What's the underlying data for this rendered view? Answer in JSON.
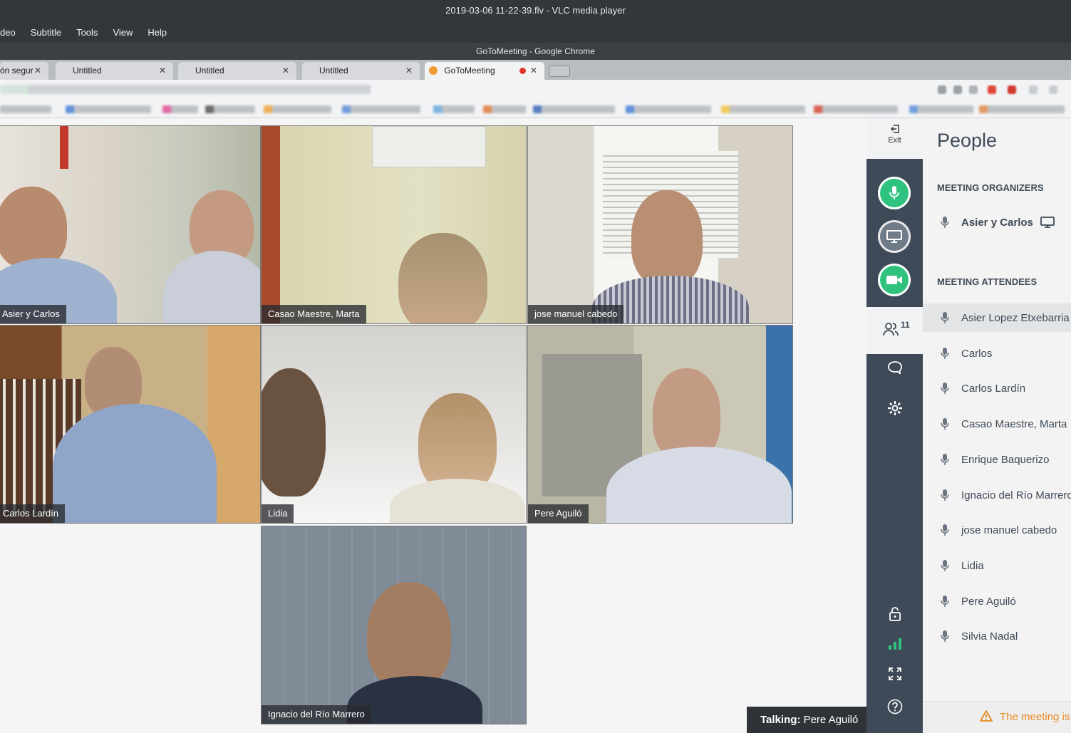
{
  "vlc": {
    "title": "2019-03-06 11-22-39.flv - VLC media player",
    "menu": [
      "deo",
      "Subtitle",
      "Tools",
      "View",
      "Help"
    ]
  },
  "chrome": {
    "title": "GoToMeeting - Google Chrome",
    "tabs": [
      {
        "label": "ón segur"
      },
      {
        "label": "Untitled"
      },
      {
        "label": "Untitled"
      },
      {
        "label": "Untitled"
      },
      {
        "label": "GoToMeeting"
      }
    ]
  },
  "meeting": {
    "tiles": [
      {
        "name": "Asier y Carlos"
      },
      {
        "name": "Casao Maestre, Marta"
      },
      {
        "name": "jose manuel cabedo"
      },
      {
        "name": "Carlos Lardín"
      },
      {
        "name": "Lidia"
      },
      {
        "name": "Pere Aguiló"
      },
      {
        "name": "Ignacio del Río Marrero"
      }
    ],
    "talking_label": "Talking:",
    "talking_name": "Pere Aguiló"
  },
  "rail": {
    "exit_label": "Exit",
    "attendee_count": "11",
    "colors": {
      "active": "#2ec27e",
      "rail": "#3e4a57"
    }
  },
  "people": {
    "title": "People",
    "organizers_heading": "MEETING ORGANIZERS",
    "organizers": [
      "Asier y Carlos"
    ],
    "attendees_heading": "MEETING ATTENDEES",
    "attendees": [
      "Asier Lopez Etxebarria",
      "Carlos",
      "Carlos Lardín",
      "Casao Maestre, Marta",
      "Enrique Baquerizo",
      "Ignacio del Río Marrero",
      "jose manuel cabedo",
      "Lidia",
      "Pere Aguiló",
      "Silvia Nadal"
    ],
    "warning": "The meeting is"
  }
}
